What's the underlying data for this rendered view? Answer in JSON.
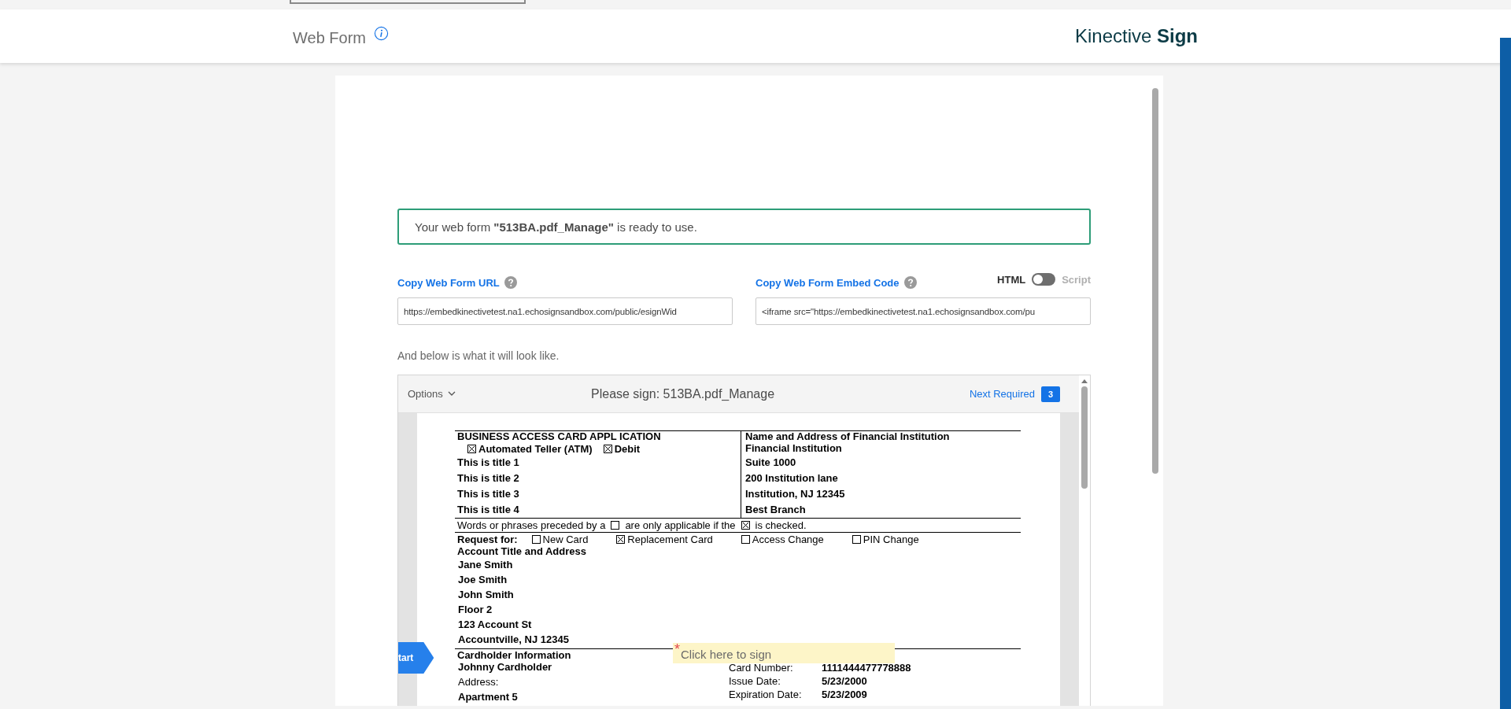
{
  "header": {
    "title": "Web Form",
    "brand_light": "Kinective",
    "brand_bold": "Sign"
  },
  "notice": {
    "text": "Your web form **\"513BA.pdf_Manage\"** is ready to use."
  },
  "url_field": {
    "label": "Copy Web Form URL",
    "value": "https://embedkinectivetest.na1.echosignsandbox.com/public/esignWid"
  },
  "embed_field": {
    "label": "Copy Web Form Embed Code",
    "value": "<iframe src=\"https://embedkinectivetest.na1.echosignsandbox.com/pu"
  },
  "embed_toggle": {
    "left_label": "HTML",
    "right_label": "Script",
    "on": false
  },
  "preview_caption": "And below is what it will look like.",
  "preview": {
    "options": "Options",
    "title": "Please sign: 513BA.pdf_Manage",
    "next_required": "Next Required",
    "required_count": "3",
    "start_tag": "tart",
    "sign_field": {
      "required_mark": "*",
      "placeholder": "Click here to sign"
    }
  },
  "document": {
    "title": "BUSINESS ACCESS CARD APPL ICATION",
    "services": [
      {
        "label": "Automated Teller (ATM)",
        "checked": true
      },
      {
        "label": "Debit",
        "checked": true
      }
    ],
    "titles": [
      "This is title 1",
      "This is title 2",
      "This is title 3",
      "This is title 4"
    ],
    "institution_heading": "Name and Address of Financial Institution",
    "institution_lines": [
      "Financial Institution",
      "Suite 1000",
      "200 Institution lane",
      "Institution, NJ 12345",
      "Best Branch"
    ],
    "note": {
      "part_1": "Words or phrases preceded by a",
      "box_1_checked": false,
      "part_2": "are only applicable if the",
      "box_2_checked": true,
      "part_3": "is checked."
    },
    "request_label": "Request for:",
    "requests": [
      {
        "label": "New Card",
        "checked": false
      },
      {
        "label": "Replacement Card",
        "checked": true
      },
      {
        "label": "Access Change",
        "checked": false
      },
      {
        "label": "PIN Change",
        "checked": false
      }
    ],
    "account_heading": "Account Title and Address",
    "account_lines": [
      "Jane Smith",
      "Joe Smith",
      "John Smith",
      "Floor 2",
      "123 Account St",
      "Accountville, NJ 12345"
    ],
    "cardholder_heading": "Cardholder Information",
    "cardholder_left": [
      {
        "text": "Johnny Cardholder",
        "bold": true
      },
      {
        "text": "Address:",
        "bold": false
      },
      {
        "text": "Apartment 5",
        "bold": true
      }
    ],
    "card_fields": [
      {
        "label": "Card Number:",
        "value": "1111444477778888"
      },
      {
        "label": "Issue Date:",
        "value": "5/23/2000"
      },
      {
        "label": "Expiration Date:",
        "value": "5/23/2009"
      }
    ]
  }
}
